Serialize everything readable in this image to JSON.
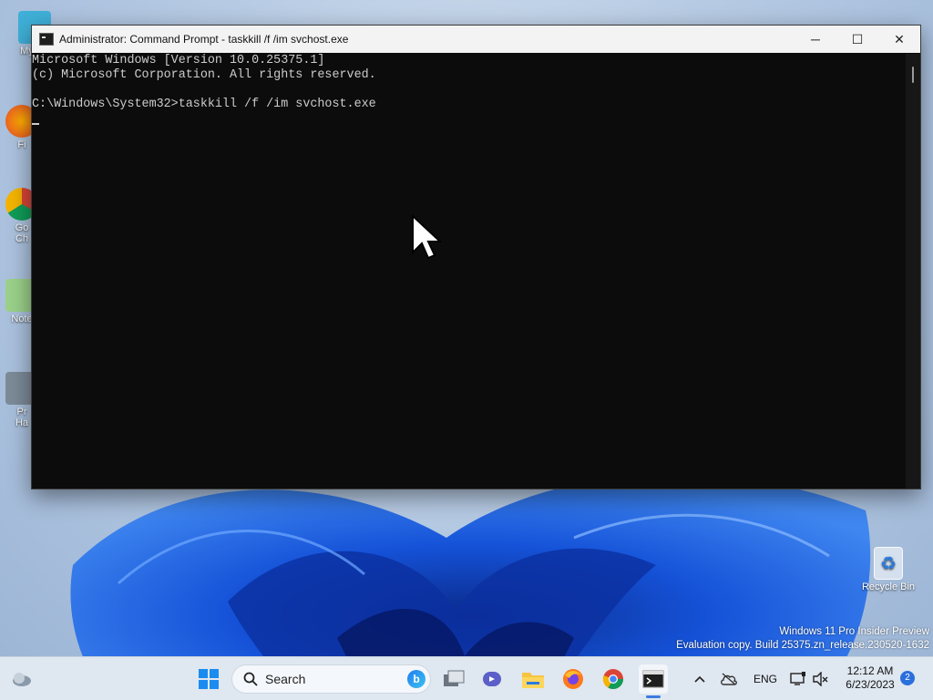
{
  "window": {
    "title": "Administrator:  Command Prompt - taskkill  /f /im svchost.exe",
    "minimize_glyph": "─",
    "maximize_glyph": "☐",
    "close_glyph": "✕"
  },
  "console": {
    "lines": [
      "Microsoft Windows [Version 10.0.25375.1]",
      "(c) Microsoft Corporation. All rights reserved.",
      "",
      "C:\\Windows\\System32>taskkill /f /im svchost.exe"
    ]
  },
  "desktop": {
    "icons": [
      {
        "label": "My Co",
        "icon": "computer-icon"
      },
      {
        "label": "Fi",
        "icon": "firefox-icon"
      },
      {
        "label": "Go\nCh",
        "icon": "chrome-icon"
      },
      {
        "label": "Note",
        "icon": "notepad-icon"
      },
      {
        "label": "Pr\nHa",
        "icon": "process-hacker-icon"
      }
    ],
    "recycle_bin": "Recycle Bin",
    "watermark_line1": "Windows 11 Pro Insider Preview",
    "watermark_line2": "Evaluation copy. Build 25375.zn_release.230520-1632"
  },
  "taskbar": {
    "search_label": "Search",
    "apps": [
      "start-icon",
      "task-view-icon",
      "teams-icon",
      "file-explorer-icon",
      "firefox-icon",
      "chrome-icon",
      "terminal-icon"
    ],
    "language": "ENG",
    "time": "12:12 AM",
    "date": "6/23/2023",
    "notification_count": "2"
  },
  "colors": {
    "console_bg": "#0c0c0c",
    "console_text": "#cccccc",
    "accent": "#2a6fdb"
  }
}
